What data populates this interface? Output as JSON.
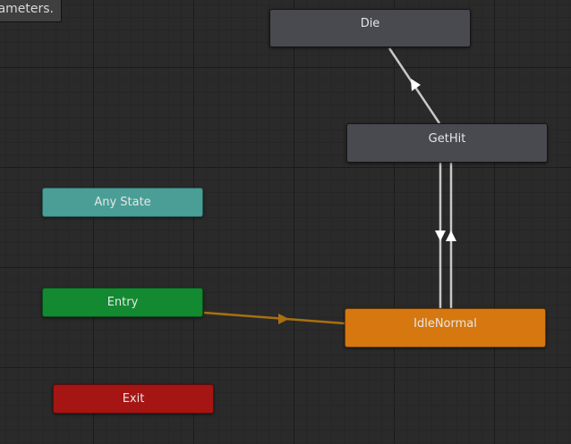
{
  "tooltip": {
    "text": "ameters."
  },
  "states": {
    "die": {
      "label": "Die",
      "color": "#484a4f"
    },
    "gethit": {
      "label": "GetHit",
      "color": "#484a4f"
    },
    "any_state": {
      "label": "Any State",
      "color": "#4a9e96"
    },
    "entry": {
      "label": "Entry",
      "color": "#138a31"
    },
    "idle_normal": {
      "label": "IdleNormal",
      "color": "#d6780f"
    },
    "exit": {
      "label": "Exit",
      "color": "#a51513"
    }
  },
  "transitions": [
    {
      "from": "GetHit",
      "to": "Die",
      "color": "#c8c8c8"
    },
    {
      "from": "GetHit",
      "to": "IdleNormal",
      "color": "#c8c8c8"
    },
    {
      "from": "IdleNormal",
      "to": "GetHit",
      "color": "#c8c8c8"
    },
    {
      "from": "Entry",
      "to": "IdleNormal",
      "color": "#a8700f"
    }
  ]
}
